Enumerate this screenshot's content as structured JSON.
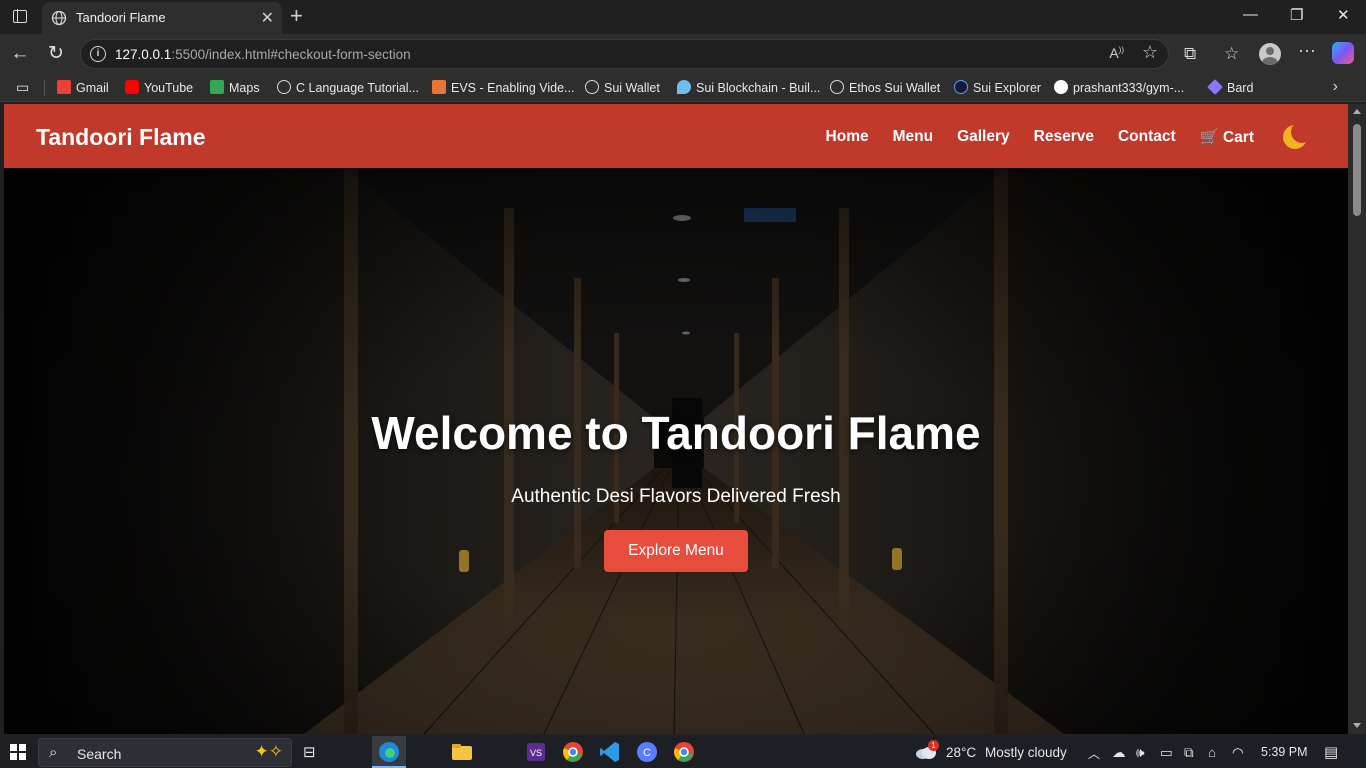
{
  "browser": {
    "tab_title": "Tandoori Flame",
    "url_host": "127.0.0.1",
    "url_path": ":5500/index.html#checkout-form-section",
    "bookmarks": [
      {
        "label": "Gmail",
        "icon": "gmail-icon",
        "color": "#ea4335"
      },
      {
        "label": "YouTube",
        "icon": "youtube-icon",
        "color": "#ff0000"
      },
      {
        "label": "Maps",
        "icon": "maps-icon",
        "color": "#34a853"
      },
      {
        "label": "C Language Tutorial...",
        "icon": "globe-icon",
        "color": "#d8d8d8"
      },
      {
        "label": "EVS - Enabling Vide...",
        "icon": "evs-icon",
        "color": "#e8743b"
      },
      {
        "label": "Sui Wallet",
        "icon": "globe-icon",
        "color": "#d8d8d8"
      },
      {
        "label": "Sui Blockchain - Buil...",
        "icon": "sui-drop-icon",
        "color": "#6fbcf0"
      },
      {
        "label": "Ethos Sui Wallet",
        "icon": "globe-icon",
        "color": "#d8d8d8"
      },
      {
        "label": "Sui Explorer",
        "icon": "sui-explorer-icon",
        "color": "#4da2ff"
      },
      {
        "label": "prashant333/gym-...",
        "icon": "github-icon",
        "color": "#ffffff"
      },
      {
        "label": "Bard",
        "icon": "bard-icon",
        "color": "#8e75ff"
      }
    ]
  },
  "site": {
    "brand": "Tandoori Flame",
    "nav": {
      "home": "Home",
      "menu": "Menu",
      "gallery": "Gallery",
      "reserve": "Reserve",
      "contact": "Contact",
      "cart": "Cart",
      "cart_icon": "🛒"
    },
    "hero": {
      "title": "Welcome to Tandoori Flame",
      "subtitle": "Authentic Desi Flavors Delivered Fresh",
      "cta": "Explore Menu"
    },
    "colors": {
      "navbar": "#c0392b",
      "cta": "#e74c3c",
      "moon": "#f5b321"
    }
  },
  "taskbar": {
    "search_label": "Search",
    "weather_badge": "1",
    "temperature": "28°C",
    "weather": "Mostly cloudy",
    "time": "5:39 PM"
  }
}
